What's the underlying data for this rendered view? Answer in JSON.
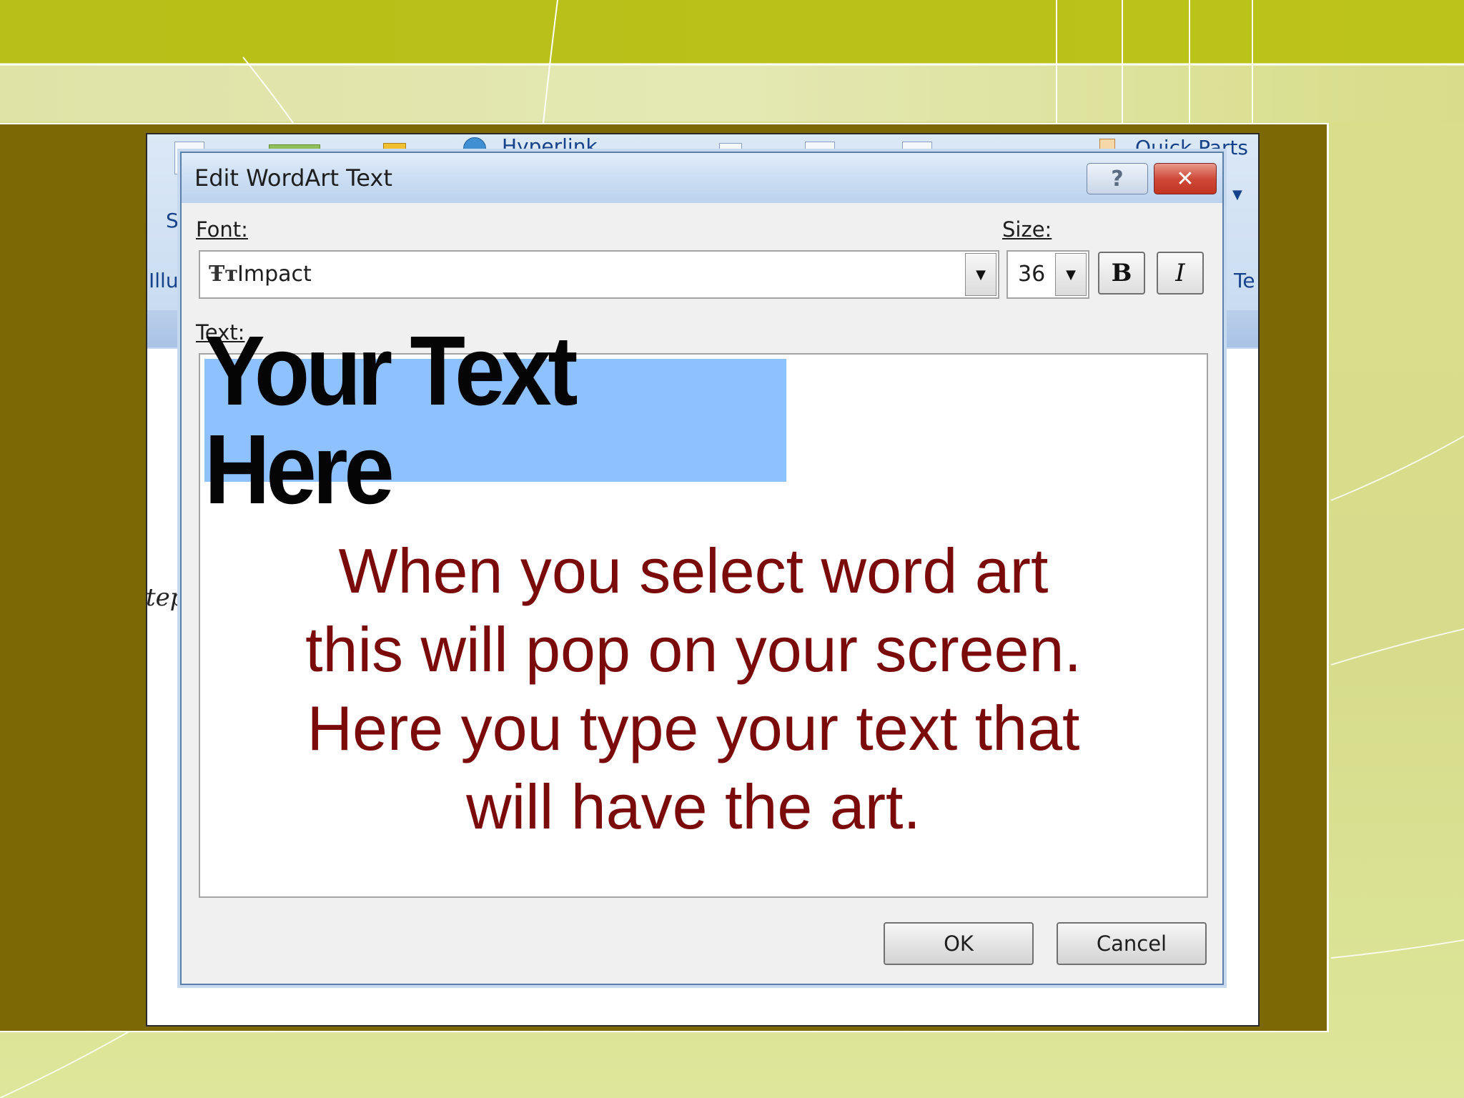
{
  "colors": {
    "olive": "#7d6806",
    "annotation_text": "#7b0b0b",
    "selection_highlight": "#8ec1ff",
    "lime_band": "#b7bf18"
  },
  "ribbon_fragments": {
    "hyperlink": "Hyperlink",
    "quick_parts": "Quick Parts",
    "s_letter": "S",
    "illu": "Illu",
    "te": "Te",
    "doc_fragment": "tep"
  },
  "dialog": {
    "title": "Edit WordArt Text",
    "help_icon": "question-mark-icon",
    "close_icon": "close-icon",
    "font_label": "Font:",
    "font_value": "Impact",
    "font_type_icon": "truetype-font-icon",
    "size_label": "Size:",
    "size_value": "36",
    "bold_label": "B",
    "italic_label": "I",
    "text_label": "Text:",
    "text_value": "Your Text Here",
    "ok_label": "OK",
    "cancel_label": "Cancel"
  },
  "annotation": {
    "lines": [
      "When you select word art",
      "this will pop on your screen.",
      "Here you type your text that",
      "will have the art."
    ]
  }
}
